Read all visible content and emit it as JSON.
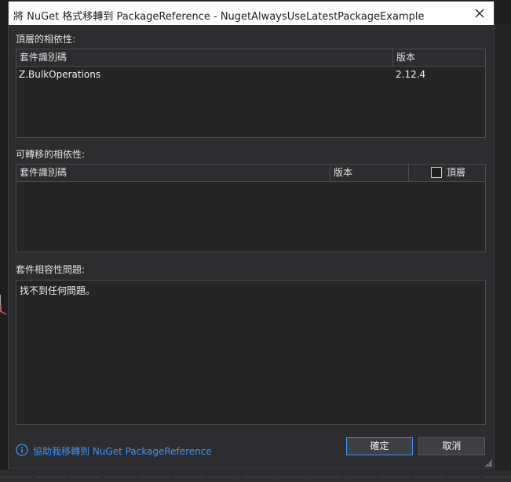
{
  "window": {
    "title": "將 NuGet 格式移轉到 PackageReference - NugetAlwaysUseLatestPackageExample"
  },
  "top_level": {
    "label": "頂層的相依性:",
    "columns": [
      "套件識別碼",
      "版本"
    ],
    "rows": [
      {
        "id": "Z.BulkOperations",
        "version": "2.12.4"
      }
    ]
  },
  "transitive": {
    "label": "可轉移的相依性:",
    "columns": [
      "套件識別碼",
      "版本",
      "頂層"
    ],
    "rows": []
  },
  "compat": {
    "label": "套件相容性問題:",
    "text": "找不到任何問題。"
  },
  "footer": {
    "help_link": "協助我移轉到 NuGet PackageReference",
    "ok_label": "確定",
    "cancel_label": "取消"
  },
  "icons": {
    "close": "close-icon",
    "info": "info-icon"
  },
  "colors": {
    "link": "#3794ff",
    "dialog_bg": "#2d2d30",
    "accent_border": "#3794ff"
  }
}
